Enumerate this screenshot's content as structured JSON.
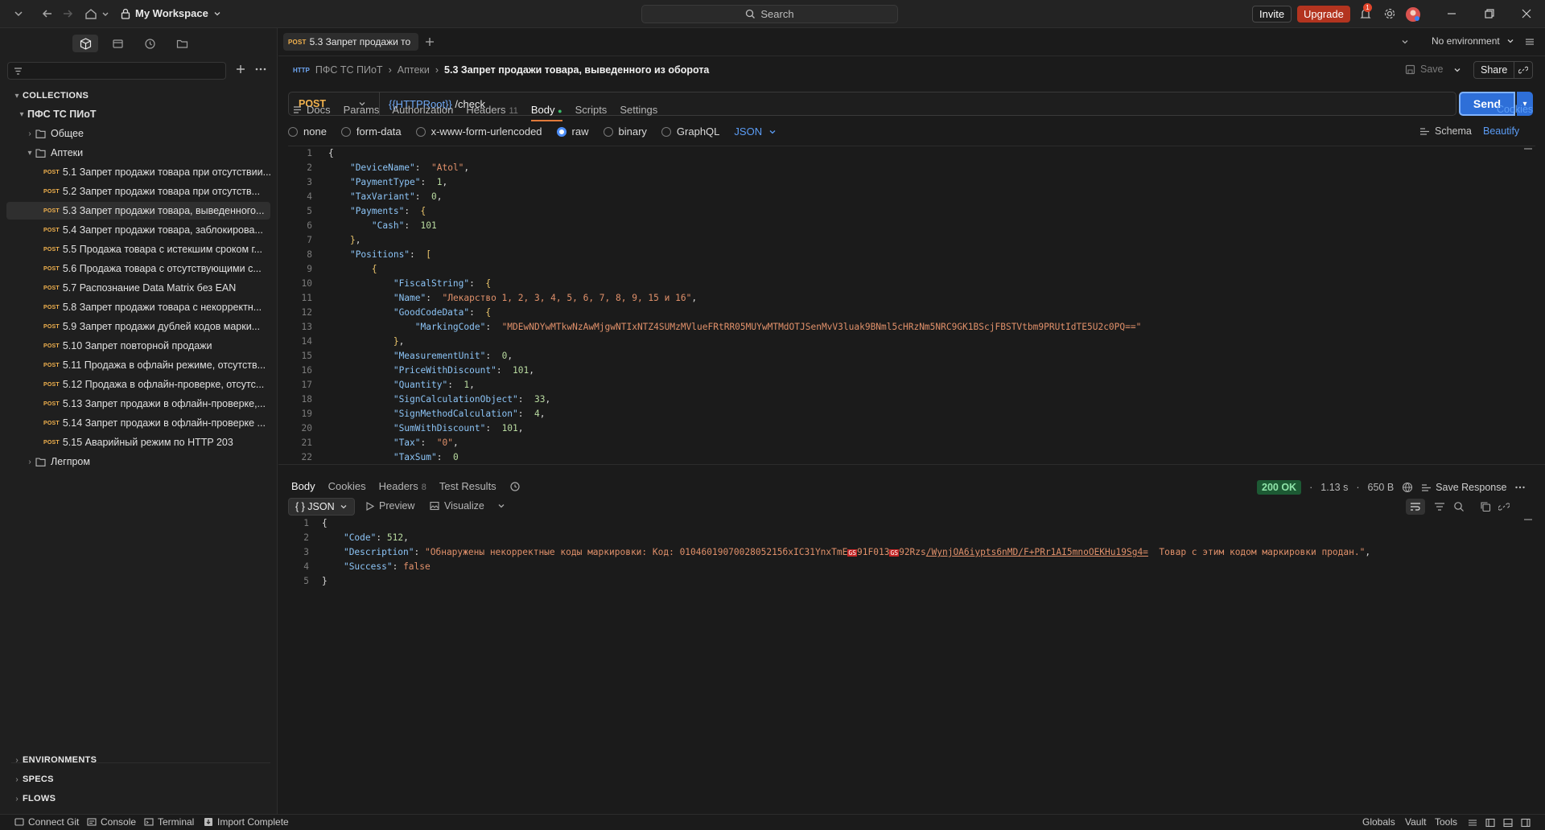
{
  "topbar": {
    "workspace": "My Workspace",
    "search_placeholder": "Search",
    "invite": "Invite",
    "upgrade": "Upgrade",
    "notif_count": "1"
  },
  "sidebar": {
    "collections_label": "COLLECTIONS",
    "collection_name": "ПФС ТС ПИоТ",
    "folders": [
      "Общее",
      "Аптеки",
      "Легпром"
    ],
    "method_label": "POST",
    "requests": [
      "5.1 Запрет продажи товара при отсутствии...",
      "5.2 Запрет продажи товара при отсутств...",
      "5.3 Запрет продажи товара, выведенного...",
      "5.4 Запрет продажи товара, заблокирова...",
      "5.5 Продажа товара с истекшим сроком г...",
      "5.6 Продажа товара с отсутствующими с...",
      "5.7 Распознание Data Matrix без EAN",
      "5.8 Запрет продажи товара с некорректн...",
      "5.9 Запрет продажи дублей кодов марки...",
      "5.10 Запрет повторной продажи",
      "5.11 Продажа в офлайн режиме, отсутств...",
      "5.12 Продажа в офлайн-проверке, отсутс...",
      "5.13 Запрет продажи в офлайн-проверке,...",
      "5.14 Запрет продажи в офлайн-проверке ...",
      "5.15 Аварийный режим по HTTP 203"
    ],
    "bottom_sections": [
      "ENVIRONMENTS",
      "SPECS",
      "FLOWS"
    ]
  },
  "tabbar": {
    "tab_method": "POST",
    "tab_label": "5.3 Запрет продажи то",
    "environment": "No environment"
  },
  "request": {
    "breadcrumb": [
      "ПФС ТС ПИоТ",
      "Аптеки",
      "5.3 Запрет продажи товара, выведенного из оборота"
    ],
    "save": "Save",
    "share": "Share",
    "method": "POST",
    "url_var": "{{HTTPRoot}}",
    "url_path": " /check",
    "send": "Send",
    "tabs": [
      "Docs",
      "Params",
      "Authorization",
      "Headers",
      "Body",
      "Scripts",
      "Settings"
    ],
    "headers_count": "11",
    "cookies": "Cookies",
    "body_modes": [
      "none",
      "form-data",
      "x-www-form-urlencoded",
      "raw",
      "binary",
      "GraphQL"
    ],
    "body_format": "JSON",
    "schema": "Schema",
    "beautify": "Beautify"
  },
  "response": {
    "tabs": [
      "Body",
      "Cookies",
      "Headers",
      "Test Results"
    ],
    "headers_count": "8",
    "status": "200 OK",
    "time": "1.13 s",
    "size": "650 B",
    "save_response": "Save Response",
    "format": "{ } JSON",
    "preview": "Preview",
    "visualize": "Visualize"
  },
  "statusbar": {
    "left": [
      "Connect Git",
      "Console",
      "Terminal",
      "Import Complete"
    ],
    "right": [
      "Globals",
      "Vault",
      "Tools"
    ]
  },
  "body_lines": [
    {
      "n": "1",
      "t": [
        [
          "p",
          "{"
        ]
      ]
    },
    {
      "n": "2",
      "t": [
        [
          "p",
          "    "
        ],
        [
          "k",
          "\"DeviceName\""
        ],
        [
          "p",
          ":  "
        ],
        [
          "s",
          "\"Atol\""
        ],
        [
          "p",
          ","
        ]
      ]
    },
    {
      "n": "3",
      "t": [
        [
          "p",
          "    "
        ],
        [
          "k",
          "\"PaymentType\""
        ],
        [
          "p",
          ":  "
        ],
        [
          "n",
          "1"
        ],
        [
          "p",
          ","
        ]
      ]
    },
    {
      "n": "4",
      "t": [
        [
          "p",
          "    "
        ],
        [
          "k",
          "\"TaxVariant\""
        ],
        [
          "p",
          ":  "
        ],
        [
          "n",
          "0"
        ],
        [
          "p",
          ","
        ]
      ]
    },
    {
      "n": "5",
      "t": [
        [
          "p",
          "    "
        ],
        [
          "k",
          "\"Payments\""
        ],
        [
          "p",
          ":  "
        ],
        [
          "b",
          "{"
        ]
      ]
    },
    {
      "n": "6",
      "t": [
        [
          "p",
          "        "
        ],
        [
          "k",
          "\"Cash\""
        ],
        [
          "p",
          ":  "
        ],
        [
          "n",
          "101"
        ]
      ]
    },
    {
      "n": "7",
      "t": [
        [
          "p",
          "    "
        ],
        [
          "b",
          "}"
        ],
        [
          "p",
          ","
        ]
      ]
    },
    {
      "n": "8",
      "t": [
        [
          "p",
          "    "
        ],
        [
          "k",
          "\"Positions\""
        ],
        [
          "p",
          ":  "
        ],
        [
          "b",
          "["
        ]
      ]
    },
    {
      "n": "9",
      "t": [
        [
          "p",
          "        "
        ],
        [
          "b",
          "{"
        ]
      ]
    },
    {
      "n": "10",
      "t": [
        [
          "p",
          "            "
        ],
        [
          "k",
          "\"FiscalString\""
        ],
        [
          "p",
          ":  "
        ],
        [
          "b",
          "{"
        ]
      ]
    },
    {
      "n": "11",
      "t": [
        [
          "p",
          "            "
        ],
        [
          "k",
          "\"Name\""
        ],
        [
          "p",
          ":  "
        ],
        [
          "s",
          "\"Лекарство 1, 2, 3, 4, 5, 6, 7, 8, 9, 15 и 16\""
        ],
        [
          "p",
          ","
        ]
      ]
    },
    {
      "n": "12",
      "t": [
        [
          "p",
          "            "
        ],
        [
          "k",
          "\"GoodCodeData\""
        ],
        [
          "p",
          ":  "
        ],
        [
          "b",
          "{"
        ]
      ]
    },
    {
      "n": "13",
      "t": [
        [
          "p",
          "                "
        ],
        [
          "k",
          "\"MarkingCode\""
        ],
        [
          "p",
          ":  "
        ],
        [
          "s",
          "\"MDEwNDYwMTkwNzAwMjgwNTIxNTZ4SUMzMVlueFRtRR05MUYwMTMdOTJSenMvV3luak9BNml5cHRzNm5NRC9GK1BScjFBSTVtbm9PRUtIdTE5U2c0PQ==\""
        ]
      ]
    },
    {
      "n": "14",
      "t": [
        [
          "p",
          "            "
        ],
        [
          "b",
          "}"
        ],
        [
          "p",
          ","
        ]
      ]
    },
    {
      "n": "15",
      "t": [
        [
          "p",
          "            "
        ],
        [
          "k",
          "\"MeasurementUnit\""
        ],
        [
          "p",
          ":  "
        ],
        [
          "n",
          "0"
        ],
        [
          "p",
          ","
        ]
      ]
    },
    {
      "n": "16",
      "t": [
        [
          "p",
          "            "
        ],
        [
          "k",
          "\"PriceWithDiscount\""
        ],
        [
          "p",
          ":  "
        ],
        [
          "n",
          "101"
        ],
        [
          "p",
          ","
        ]
      ]
    },
    {
      "n": "17",
      "t": [
        [
          "p",
          "            "
        ],
        [
          "k",
          "\"Quantity\""
        ],
        [
          "p",
          ":  "
        ],
        [
          "n",
          "1"
        ],
        [
          "p",
          ","
        ]
      ]
    },
    {
      "n": "18",
      "t": [
        [
          "p",
          "            "
        ],
        [
          "k",
          "\"SignCalculationObject\""
        ],
        [
          "p",
          ":  "
        ],
        [
          "n",
          "33"
        ],
        [
          "p",
          ","
        ]
      ]
    },
    {
      "n": "19",
      "t": [
        [
          "p",
          "            "
        ],
        [
          "k",
          "\"SignMethodCalculation\""
        ],
        [
          "p",
          ":  "
        ],
        [
          "n",
          "4"
        ],
        [
          "p",
          ","
        ]
      ]
    },
    {
      "n": "20",
      "t": [
        [
          "p",
          "            "
        ],
        [
          "k",
          "\"SumWithDiscount\""
        ],
        [
          "p",
          ":  "
        ],
        [
          "n",
          "101"
        ],
        [
          "p",
          ","
        ]
      ]
    },
    {
      "n": "21",
      "t": [
        [
          "p",
          "            "
        ],
        [
          "k",
          "\"Tax\""
        ],
        [
          "p",
          ":  "
        ],
        [
          "s",
          "\"0\""
        ],
        [
          "p",
          ","
        ]
      ]
    },
    {
      "n": "22",
      "t": [
        [
          "p",
          "            "
        ],
        [
          "k",
          "\"TaxSum\""
        ],
        [
          "p",
          ":  "
        ],
        [
          "n",
          "0"
        ]
      ]
    },
    {
      "n": "23",
      "t": [
        [
          "p",
          "            "
        ],
        [
          "b",
          "}"
        ]
      ]
    },
    {
      "n": "24",
      "t": [
        [
          "p",
          "        "
        ],
        [
          "b",
          "}"
        ]
      ]
    },
    {
      "n": "25",
      "t": [
        [
          "p",
          "    "
        ],
        [
          "b",
          "]"
        ]
      ]
    },
    {
      "n": "26",
      "t": [
        [
          "p",
          "}"
        ]
      ]
    }
  ],
  "response_lines": [
    {
      "n": "1",
      "t": [
        [
          "p",
          "{"
        ]
      ]
    },
    {
      "n": "2",
      "t": [
        [
          "p",
          "    "
        ],
        [
          "k",
          "\"Code\""
        ],
        [
          "p",
          ": "
        ],
        [
          "n",
          "512"
        ],
        [
          "p",
          ","
        ]
      ]
    },
    {
      "n": "3",
      "t": [
        [
          "p",
          "    "
        ],
        [
          "k",
          "\"Description\""
        ],
        [
          "p",
          ": "
        ],
        [
          "s",
          "\"Обнаружены некорректные коды маркировки: Код: 0104601907002805215бxIC31YnxTmE"
        ],
        [
          "r",
          "GS"
        ],
        [
          "s",
          "91F013"
        ],
        [
          "r",
          "GS"
        ],
        [
          "s",
          "92Rzs"
        ],
        [
          "u",
          "/WynjOA6iypts6nMD/F+PRr1AI5mnoOEKHu19Sg4="
        ],
        [
          "s",
          "  Товар с этим кодом маркировки продан.\""
        ],
        [
          "p",
          ","
        ]
      ]
    },
    {
      "n": "4",
      "t": [
        [
          "p",
          "    "
        ],
        [
          "k",
          "\"Success\""
        ],
        [
          "p",
          ": "
        ],
        [
          "s",
          "false"
        ]
      ]
    },
    {
      "n": "5",
      "t": [
        [
          "p",
          "}"
        ]
      ]
    }
  ]
}
